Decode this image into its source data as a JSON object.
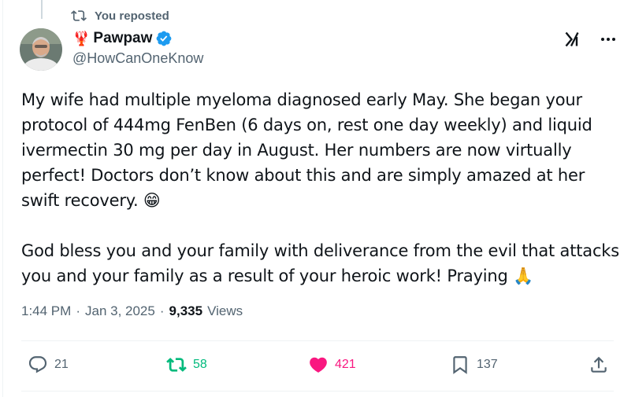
{
  "repost": {
    "label": "You reposted",
    "icon": "repost-icon"
  },
  "author": {
    "emoji": "🦞",
    "display_name": "Pawpaw",
    "handle": "@HowCanOneKnow",
    "verified": true
  },
  "tweet": {
    "text": "My wife had multiple myeloma diagnosed early May. She began your\nprotocol of 444mg FenBen (6 days on, rest one day weekly) and liquid\nivermectin 30 mg per day in August. Her numbers are now virtually\nperfect!  Doctors don’t know about this and are simply amazed at her\nswift recovery. 😁\n\nGod bless you and your family with deliverance from the evil that attacks\nyou and your family as a result of your heroic work! Praying 🙏"
  },
  "meta": {
    "time": "1:44 PM",
    "date": "Jan 3, 2025",
    "separator": "·",
    "views_count": "9,335",
    "views_label": "Views"
  },
  "actions": {
    "replies": "21",
    "reposts": "58",
    "likes": "421",
    "bookmarks": "137"
  },
  "colors": {
    "accent": "#1d9bf0",
    "repost_active": "#00ba7c",
    "like_active": "#f91880",
    "muted": "#536471",
    "text": "#0f1419"
  }
}
